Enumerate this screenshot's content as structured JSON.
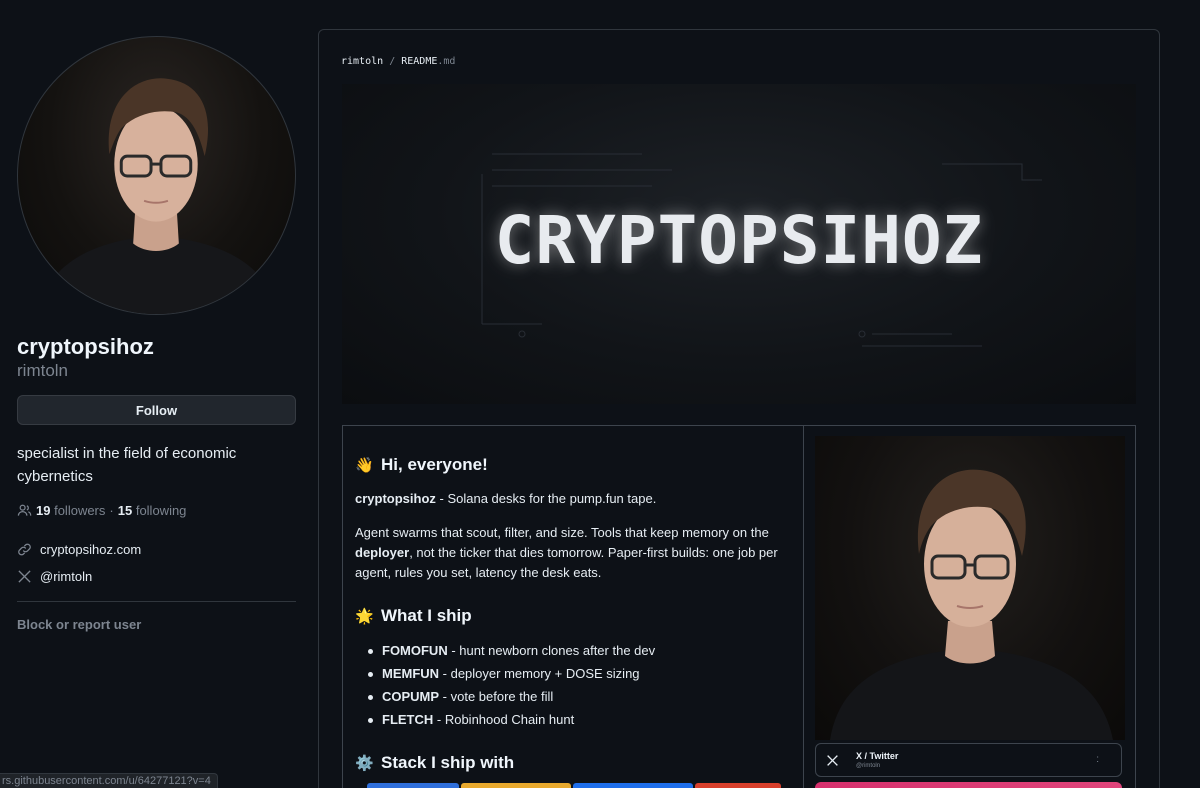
{
  "profile": {
    "display_name": "cryptopsihoz",
    "login": "rimtoln",
    "follow_label": "Follow",
    "bio": "specialist in the field of economic cybernetics",
    "followers_count": "19",
    "followers_label": "followers",
    "dot": "·",
    "following_count": "15",
    "following_label": "following",
    "website": "cryptopsihoz.com",
    "twitter": "@rimtoln",
    "block_label": "Block or report user"
  },
  "status_bar": {
    "url": "rs.githubusercontent.com/u/64277121?v=4"
  },
  "readme": {
    "breadcrumb_user": "rimtoln",
    "breadcrumb_sep": "/",
    "breadcrumb_file_name": "README",
    "breadcrumb_file_ext": ".md",
    "banner_title": "CRYPTOPSIHOZ",
    "greeting": {
      "emoji": "👋",
      "title": "Hi, everyone!"
    },
    "intro_strong": "cryptopsihoz",
    "intro_rest": " - Solana desks for the pump.fun tape.",
    "para_part1": "Agent swarms that scout, filter, and size. Tools that keep memory on the ",
    "para_strong": "deployer",
    "para_part2": ", not the ticker that dies tomorrow. Paper-first builds: one job per agent, rules you set, latency the desk eats.",
    "ship_heading": {
      "emoji": "🌟",
      "title": "What I ship"
    },
    "ship_items": [
      {
        "name": "FOMOFUN",
        "desc": " - hunt newborn clones after the dev"
      },
      {
        "name": "MEMFUN",
        "desc": " - deployer memory + DOSE sizing"
      },
      {
        "name": "COPUMP",
        "desc": " - vote before the fill"
      },
      {
        "name": "FLETCH",
        "desc": " - Robinhood Chain hunt"
      }
    ],
    "stack_heading": {
      "emoji": "⚙️",
      "title": "Stack I ship with"
    },
    "twitter_card": {
      "title": "X / Twitter",
      "handle": "@rimtoln",
      "more": ":"
    }
  },
  "colors": {
    "page_bg": "#0d1117",
    "border": "#30363d",
    "muted": "#7d8590",
    "badge_colors": [
      "#2f6fdb",
      "#e8a92e",
      "#1f6feb",
      "#d8402c"
    ],
    "pink_bar": "#d6306d"
  },
  "icons": [
    "people-icon",
    "link-icon",
    "x-logo-icon"
  ]
}
